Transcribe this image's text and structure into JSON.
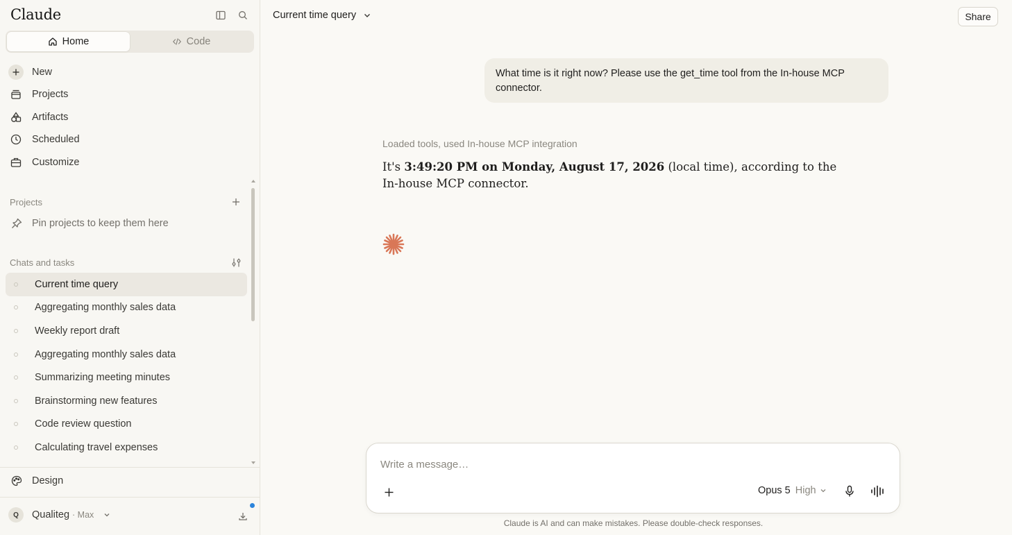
{
  "sidebar": {
    "brand": "Claude",
    "mode_tabs": [
      {
        "label": "Home",
        "icon": "home-icon",
        "active": true
      },
      {
        "label": "Code",
        "icon": "code-icon",
        "active": false
      }
    ],
    "nav": [
      {
        "label": "New",
        "icon": "plus-icon"
      },
      {
        "label": "Projects",
        "icon": "projects-icon"
      },
      {
        "label": "Artifacts",
        "icon": "artifacts-icon"
      },
      {
        "label": "Scheduled",
        "icon": "clock-icon"
      },
      {
        "label": "Customize",
        "icon": "briefcase-icon"
      }
    ],
    "projects_label": "Projects",
    "pin_hint": "Pin projects to keep them here",
    "chats_label": "Chats and tasks",
    "chats": [
      {
        "label": "Current time query",
        "active": true
      },
      {
        "label": "Aggregating monthly sales data"
      },
      {
        "label": "Weekly report draft"
      },
      {
        "label": "Aggregating monthly sales data"
      },
      {
        "label": "Summarizing meeting minutes"
      },
      {
        "label": "Brainstorming new features"
      },
      {
        "label": "Code review question"
      },
      {
        "label": "Calculating travel expenses"
      }
    ],
    "design_label": "Design",
    "user": {
      "initial": "Q",
      "name": "Qualiteg",
      "plan": "· Max"
    }
  },
  "main": {
    "chat_title": "Current time query",
    "share_label": "Share",
    "user_message": "What time is it right now? Please use the get_time tool from the In-house MCP connector.",
    "tool_note": "Loaded tools, used In-house MCP integration",
    "answer": {
      "prefix": "It's ",
      "bold": "3:49:20 PM on Monday, August 17, 2026",
      "suffix": " (local time), according to the In-house MCP connector."
    },
    "composer": {
      "placeholder": "Write a message…",
      "model": "Opus 5",
      "effort": "High"
    },
    "disclaimer": "Claude is AI and can make mistakes. Please double-check responses."
  },
  "colors": {
    "accent": "#d97757",
    "background": "#faf9f5",
    "sidebar": "#f8f7f3",
    "notification": "#2c84db"
  }
}
